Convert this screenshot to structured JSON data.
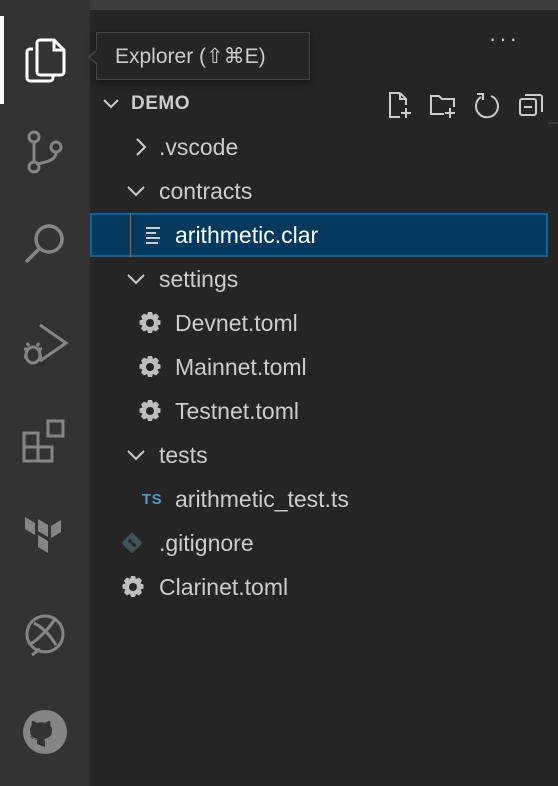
{
  "tooltip": {
    "text": "Explorer (⇧⌘E)"
  },
  "activity_bar": {
    "items": [
      {
        "name": "Explorer",
        "icon": "files-icon",
        "active": true
      },
      {
        "name": "Source Control",
        "icon": "source-control-icon"
      },
      {
        "name": "Search",
        "icon": "search-icon"
      },
      {
        "name": "Run and Debug",
        "icon": "debug-icon"
      },
      {
        "name": "Extensions",
        "icon": "extensions-icon"
      },
      {
        "name": "Terraform",
        "icon": "terraform-icon"
      },
      {
        "name": "Remote Explorer",
        "icon": "remote-explorer-icon"
      },
      {
        "name": "GitHub",
        "icon": "github-icon"
      }
    ]
  },
  "explorer": {
    "more_label": "···",
    "section_title": "DEMO",
    "actions": [
      "new-file-icon",
      "new-folder-icon",
      "refresh-icon",
      "collapse-all-icon"
    ],
    "tree": [
      {
        "label": ".vscode",
        "type": "folder",
        "expanded": false,
        "depth": 0
      },
      {
        "label": "contracts",
        "type": "folder",
        "expanded": true,
        "depth": 0
      },
      {
        "label": "arithmetic.clar",
        "type": "file",
        "icon": "lines-file-icon",
        "depth": 1,
        "selected": true
      },
      {
        "label": "settings",
        "type": "folder",
        "expanded": true,
        "depth": 0
      },
      {
        "label": "Devnet.toml",
        "type": "file",
        "icon": "gear-file-icon",
        "depth": 1
      },
      {
        "label": "Mainnet.toml",
        "type": "file",
        "icon": "gear-file-icon",
        "depth": 1
      },
      {
        "label": "Testnet.toml",
        "type": "file",
        "icon": "gear-file-icon",
        "depth": 1
      },
      {
        "label": "tests",
        "type": "folder",
        "expanded": true,
        "depth": 0
      },
      {
        "label": "arithmetic_test.ts",
        "type": "file",
        "icon": "typescript-icon",
        "badge": "TS",
        "depth": 1
      },
      {
        "label": ".gitignore",
        "type": "file",
        "icon": "git-icon",
        "depth": 0
      },
      {
        "label": "Clarinet.toml",
        "type": "file",
        "icon": "gear-file-icon",
        "depth": 0
      }
    ]
  },
  "colors": {
    "activity_bar_bg": "#333333",
    "sidebar_bg": "#252526",
    "selection_bg": "#04395e",
    "selection_border": "#0e639c",
    "ts_blue": "#519aba",
    "git_blue": "#41535b"
  }
}
